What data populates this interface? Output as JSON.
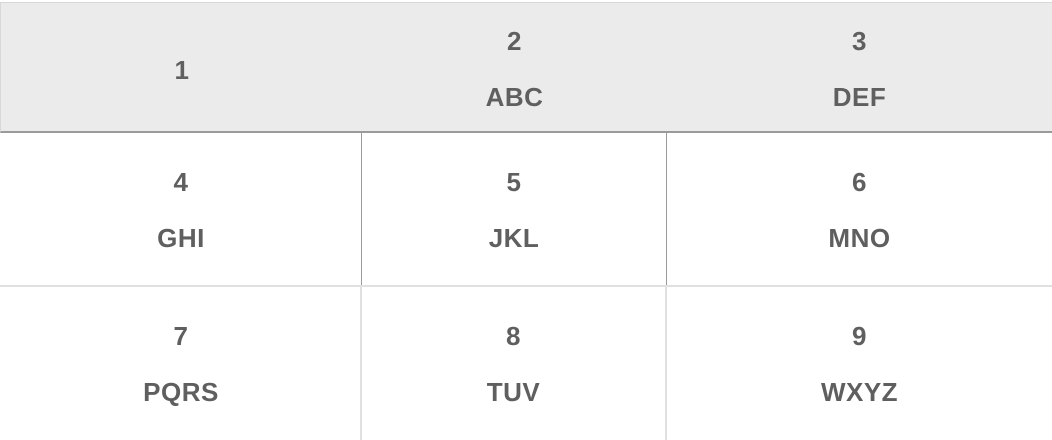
{
  "keypad": {
    "keys": [
      {
        "digit": "1",
        "letters": ""
      },
      {
        "digit": "2",
        "letters": "ABC"
      },
      {
        "digit": "3",
        "letters": "DEF"
      },
      {
        "digit": "4",
        "letters": "GHI"
      },
      {
        "digit": "5",
        "letters": "JKL"
      },
      {
        "digit": "6",
        "letters": "MNO"
      },
      {
        "digit": "7",
        "letters": "PQRS"
      },
      {
        "digit": "8",
        "letters": "TUV"
      },
      {
        "digit": "9",
        "letters": "WXYZ"
      }
    ],
    "colors": {
      "text": "#5f5f5f",
      "highlight_row": "#ebebeb",
      "divider": "#e0e0e0",
      "divider_dark": "#9a9a9a"
    }
  }
}
